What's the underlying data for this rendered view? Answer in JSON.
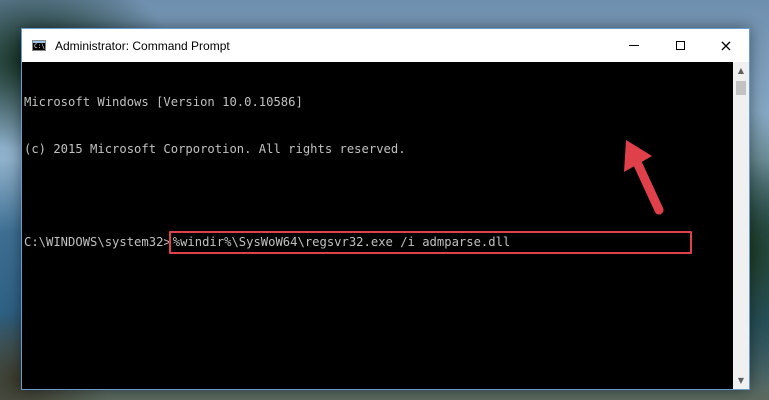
{
  "window": {
    "title": "Administrator: Command Prompt",
    "icon": "cmd-icon",
    "icon_text": "C:\\",
    "controls": {
      "minimize": "minimize-icon",
      "maximize": "maximize-icon",
      "close": "×"
    }
  },
  "console": {
    "lines": [
      "Microsoft Windows [Version 10.0.10586]",
      "(c) 2015 Microsoft Corporotion. All rights reserved.",
      ""
    ],
    "prompt": "C:\\WINDOWS\\system32>",
    "command": "%windir%\\SysWoW64\\regsvr32.exe /i admparse.dll"
  },
  "annotation": {
    "highlight_color": "#e0404a",
    "arrow_icon": "red-arrow-icon"
  }
}
